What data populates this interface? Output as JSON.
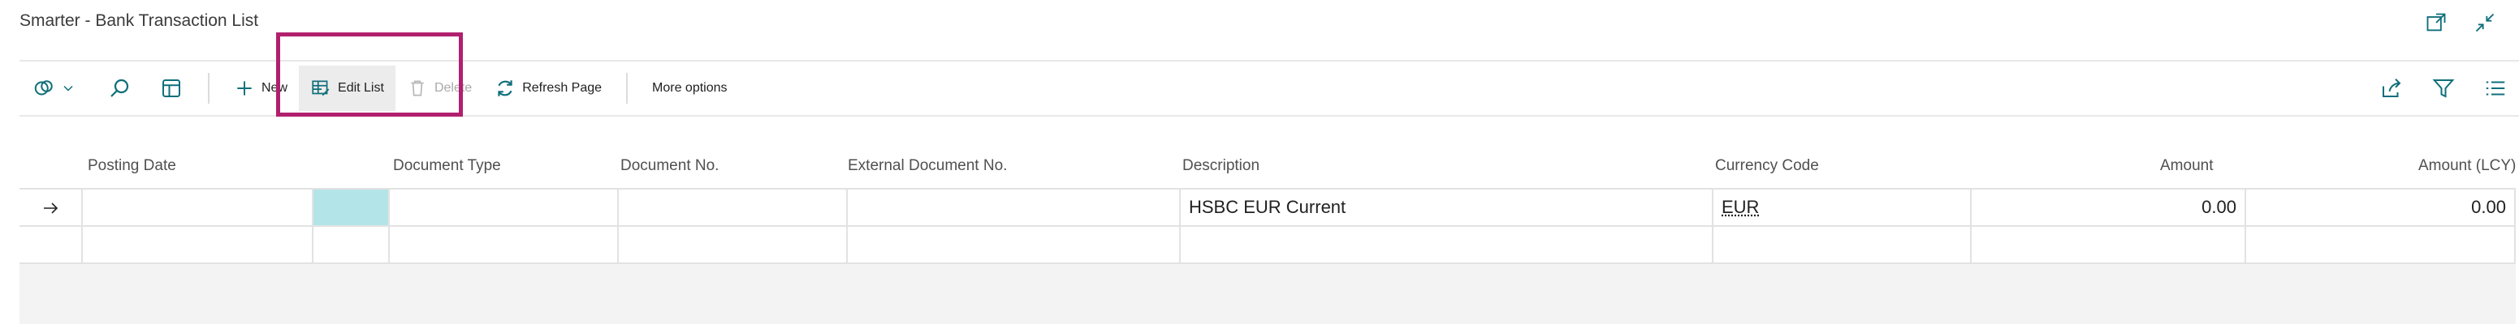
{
  "page": {
    "title": "Smarter - Bank Transaction List"
  },
  "window_icons": [
    "open-in-new-window-icon",
    "collapse-icon"
  ],
  "toolbar": {
    "new_label": "New",
    "edit_list_label": "Edit List",
    "delete_label": "Delete",
    "refresh_label": "Refresh Page",
    "more_options_label": "More options"
  },
  "table": {
    "columns": {
      "posting_date": "Posting Date",
      "document_type": "Document Type",
      "document_no": "Document No.",
      "external_document_no": "External Document No.",
      "description": "Description",
      "currency_code": "Currency Code",
      "amount": "Amount",
      "amount_lcy": "Amount (LCY)"
    },
    "rows": [
      {
        "posting_date": "",
        "document_type": "",
        "document_no": "",
        "external_document_no": "",
        "description": "HSBC EUR Current",
        "currency_code": "EUR",
        "amount": "0.00",
        "amount_lcy": "0.00"
      },
      {
        "posting_date": "",
        "document_type": "",
        "document_no": "",
        "external_document_no": "",
        "description": "",
        "currency_code": "",
        "amount": "",
        "amount_lcy": ""
      }
    ]
  },
  "colors": {
    "accent": "#0f6f7b",
    "highlight_border": "#b1206e",
    "selected_cell": "#b3e5e8"
  }
}
